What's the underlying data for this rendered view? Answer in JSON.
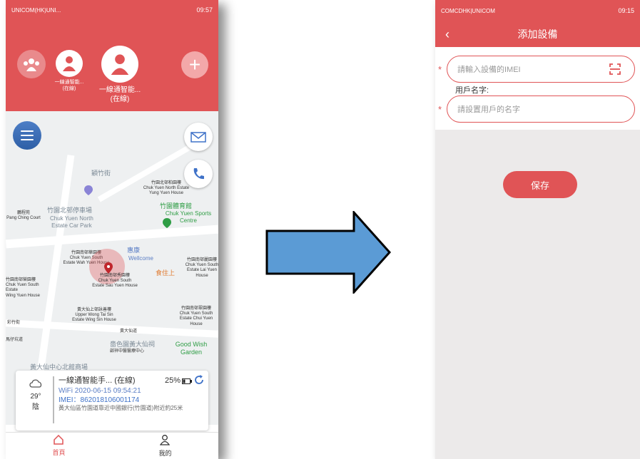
{
  "left_screen": {
    "status": {
      "left": "UNICOM(HK)UNI...",
      "right": "09:57"
    },
    "devices": {
      "small_label": "一線通智能...\n(在線)",
      "big_label": "一線通智能...\n(在線)"
    },
    "map_labels": {
      "street_top": "穎竹街",
      "north_house": "竹園北邨柏園樓\nChuk Yuen North Estate\nYung Yuen House",
      "car_park_cn": "竹園北邨停車場",
      "car_park_en": "Chuk Yuen North\nEstate Car Park",
      "pang_ching": "鵬程苑\nPang Ching Court",
      "sports_cn": "竹園體育館",
      "sports_en": "Chuk Yuen Sports Centre",
      "wah_yuen": "竹園南邨華園樓\nChuk Yuen South\nEstate Wah Yuen House",
      "wellcome_cn": "惠康",
      "wellcome_en": "Wellcome",
      "lai_yuen": "竹園南邨麗園樓\nChuk Yuen South\nEstate Lai Yuen House",
      "sau_yuen": "竹園南邨秀園樓\nChuk Yuen South\nEstate Sau Yuen House",
      "wing_yuen": "竹園南邨榮園樓\nChuk Yuen South Estate\nWing Yuen House",
      "shik_sik": "食住上",
      "wong_tai_sin": "黃大仙上邨詠善樓\nUpper Wong Tai Sin\nEstate Wing Sin House",
      "chui_yuen": "竹園南邨翠園樓\nChuk Yuen South\nEstate Chui Yuen House",
      "road_mid": "黃大仙道",
      "road_left": "彩竹街",
      "road_left2": "馬仔坑道",
      "good_wish": "Good Wish Garden",
      "sik_sik_cn": "嗇色園黃大仙祠",
      "sik_sik_sub": "啟祥中醫醫療中心",
      "temple_bottom": "黃大仙中心北館商場"
    },
    "card": {
      "weather_temp": "29°",
      "weather_desc": "陰",
      "name": "一線通智能手...",
      "status": "(在線)",
      "battery": "25%",
      "wifi_time": "WiFi 2020-06-15 09:54:21",
      "imei": "IMEI：862018106001174",
      "address": "黃大仙區竹園道靠近中國銀行(竹園道)附近約25米"
    },
    "nav": {
      "home": "首頁",
      "mine": "我的"
    }
  },
  "right_screen": {
    "status": {
      "left": "COMCDHK|UNICOM",
      "right": "09:15"
    },
    "title": "添加設備",
    "imei_placeholder": "請輸入設備的IMEI",
    "user_label": "用戶名字:",
    "name_placeholder": "請設置用戶的名字",
    "save": "保存"
  },
  "colors": {
    "accent": "#e05456",
    "arrow": "#5b9bd5"
  }
}
